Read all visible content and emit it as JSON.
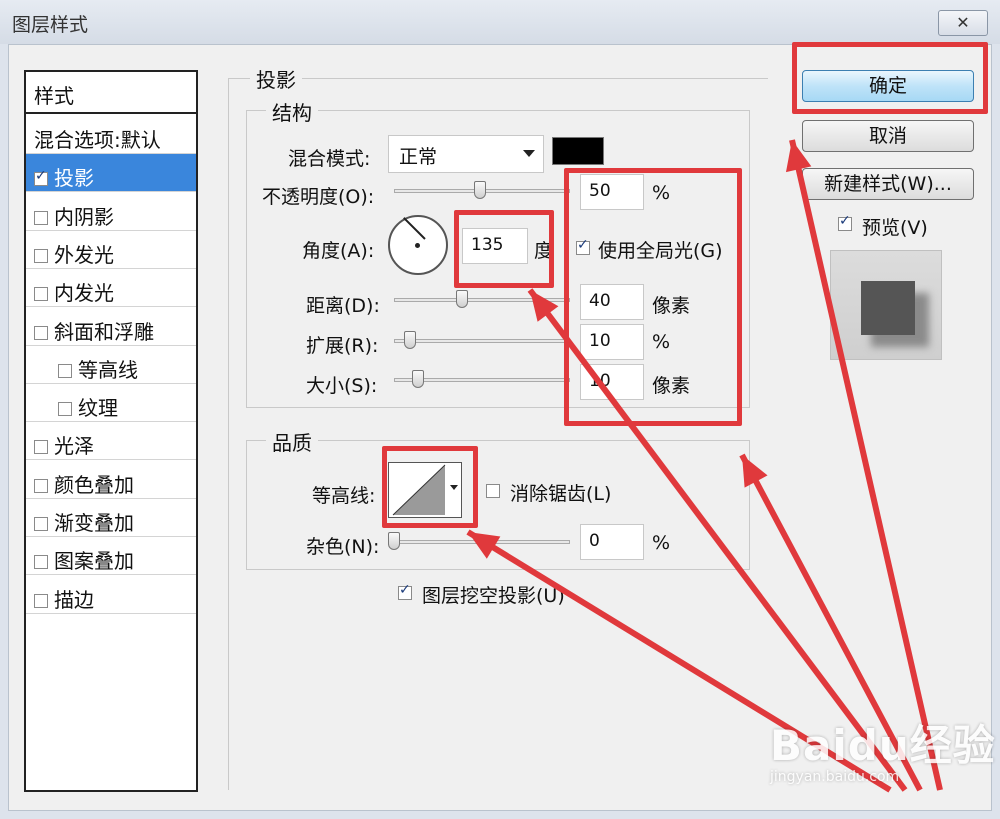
{
  "window": {
    "title": "图层样式",
    "close_symbol": "✕"
  },
  "style_list": {
    "header": "样式",
    "items": [
      {
        "label": "混合选项:默认",
        "checkbox": false,
        "checked": false,
        "indent": false,
        "selected": false
      },
      {
        "label": "投影",
        "checkbox": true,
        "checked": true,
        "indent": false,
        "selected": true
      },
      {
        "label": "内阴影",
        "checkbox": true,
        "checked": false,
        "indent": false,
        "selected": false
      },
      {
        "label": "外发光",
        "checkbox": true,
        "checked": false,
        "indent": false,
        "selected": false
      },
      {
        "label": "内发光",
        "checkbox": true,
        "checked": false,
        "indent": false,
        "selected": false
      },
      {
        "label": "斜面和浮雕",
        "checkbox": true,
        "checked": false,
        "indent": false,
        "selected": false
      },
      {
        "label": "等高线",
        "checkbox": true,
        "checked": false,
        "indent": true,
        "selected": false
      },
      {
        "label": "纹理",
        "checkbox": true,
        "checked": false,
        "indent": true,
        "selected": false
      },
      {
        "label": "光泽",
        "checkbox": true,
        "checked": false,
        "indent": false,
        "selected": false
      },
      {
        "label": "颜色叠加",
        "checkbox": true,
        "checked": false,
        "indent": false,
        "selected": false
      },
      {
        "label": "渐变叠加",
        "checkbox": true,
        "checked": false,
        "indent": false,
        "selected": false
      },
      {
        "label": "图案叠加",
        "checkbox": true,
        "checked": false,
        "indent": false,
        "selected": false
      },
      {
        "label": "描边",
        "checkbox": true,
        "checked": false,
        "indent": false,
        "selected": false
      }
    ]
  },
  "shadow": {
    "legend": "投影",
    "structure": {
      "legend": "结构",
      "blend_mode_label": "混合模式:",
      "blend_mode_value": "正常",
      "shadow_color": "#000000",
      "opacity_label": "不透明度(O):",
      "opacity_value": "50",
      "opacity_unit": "%",
      "opacity_level": 0.5,
      "angle_label": "角度(A):",
      "angle_value": "135",
      "angle_unit": "度",
      "global_light_label": "使用全局光(G)",
      "global_light_checked": true,
      "distance_label": "距离(D):",
      "distance_value": "40",
      "distance_unit": "像素",
      "spread_label": "扩展(R):",
      "spread_value": "10",
      "spread_unit": "%",
      "size_label": "大小(S):",
      "size_value": "10",
      "size_unit": "像素"
    },
    "quality": {
      "legend": "品质",
      "contour_label": "等高线:",
      "antialias_label": "消除锯齿(L)",
      "antialias_checked": false,
      "noise_label": "杂色(N):",
      "noise_value": "0",
      "noise_unit": "%"
    },
    "knockout_label": "图层挖空投影(U)",
    "knockout_checked": true
  },
  "buttons": {
    "ok": "确定",
    "cancel": "取消",
    "new_style": "新建样式(W)...",
    "preview_label": "预览(V)",
    "preview_checked": true
  },
  "annotation_color": "#e0393c",
  "watermark": {
    "main": "Baidu经验",
    "sub": "jingyan.baidu.com"
  }
}
